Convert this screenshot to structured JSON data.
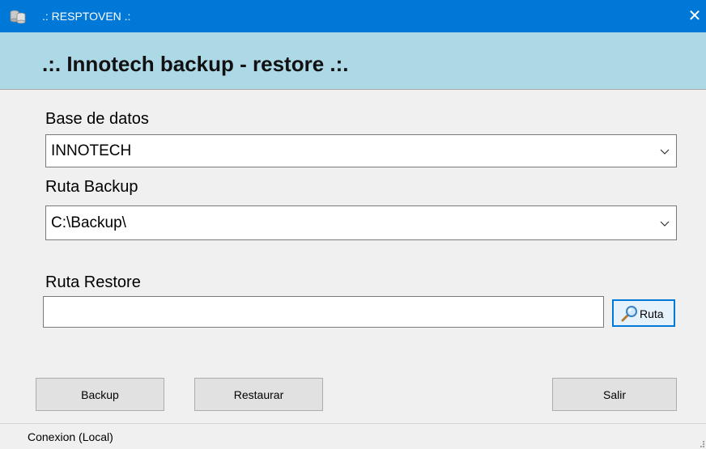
{
  "window": {
    "title": ".: RESPTOVEN .:",
    "close_label": "✕",
    "accent_color": "#0078d7"
  },
  "banner": {
    "title": ".:. Innotech backup - restore .:.",
    "background_color": "#add8e6"
  },
  "form": {
    "database_label": "Base de datos",
    "database_value": "INNOTECH",
    "backup_path_label": "Ruta Backup",
    "backup_path_value": "C:\\Backup\\",
    "restore_path_label": "Ruta Restore",
    "restore_path_value": "",
    "browse_button_label": "Ruta"
  },
  "actions": {
    "backup_label": "Backup",
    "restore_label": "Restaurar",
    "exit_label": "Salir"
  },
  "status": {
    "connection_text": "Conexion (Local)"
  },
  "icons": {
    "app": "database-icon",
    "browse": "magnifier-icon",
    "dropdown": "chevron-down-icon",
    "close": "close-icon",
    "resize": "resize-grip-icon"
  }
}
